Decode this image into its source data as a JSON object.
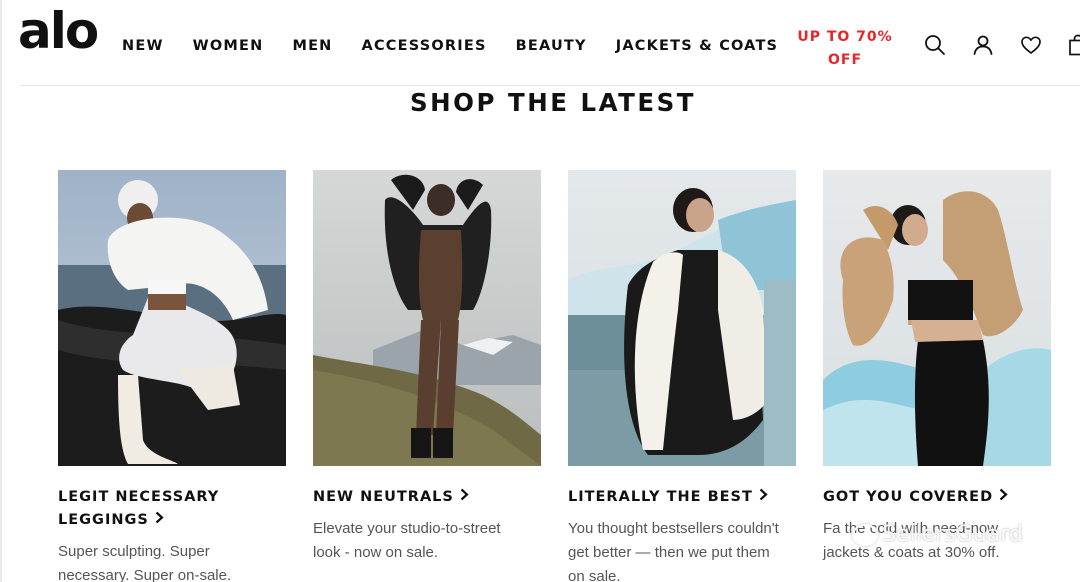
{
  "header": {
    "logo": "alo",
    "nav": [
      "NEW",
      "WOMEN",
      "MEN",
      "ACCESSORIES",
      "BEAUTY",
      "JACKETS & COATS"
    ],
    "sale_line1": "UP TO 70%",
    "sale_line2": "OFF",
    "icons": [
      "search-icon",
      "account-icon",
      "wishlist-heart-icon",
      "bag-icon"
    ],
    "sale_color": "#e8252a"
  },
  "section": {
    "title": "SHOP THE LATEST"
  },
  "cards": [
    {
      "title": "LEGIT NECESSARY LEGGINGS",
      "description": "Super sculpting. Super necessary. Super on-sale."
    },
    {
      "title": "NEW NEUTRALS",
      "description": "Elevate your studio-to-street look - now on sale."
    },
    {
      "title": "LITERALLY THE BEST",
      "description": "You thought bestsellers couldn't get better — then we put them on sale."
    },
    {
      "title": "GOT YOU COVERED",
      "description": "Fa   the cold with need-now jackets & coats at 30% off."
    }
  ],
  "watermark": "SellersGuard"
}
